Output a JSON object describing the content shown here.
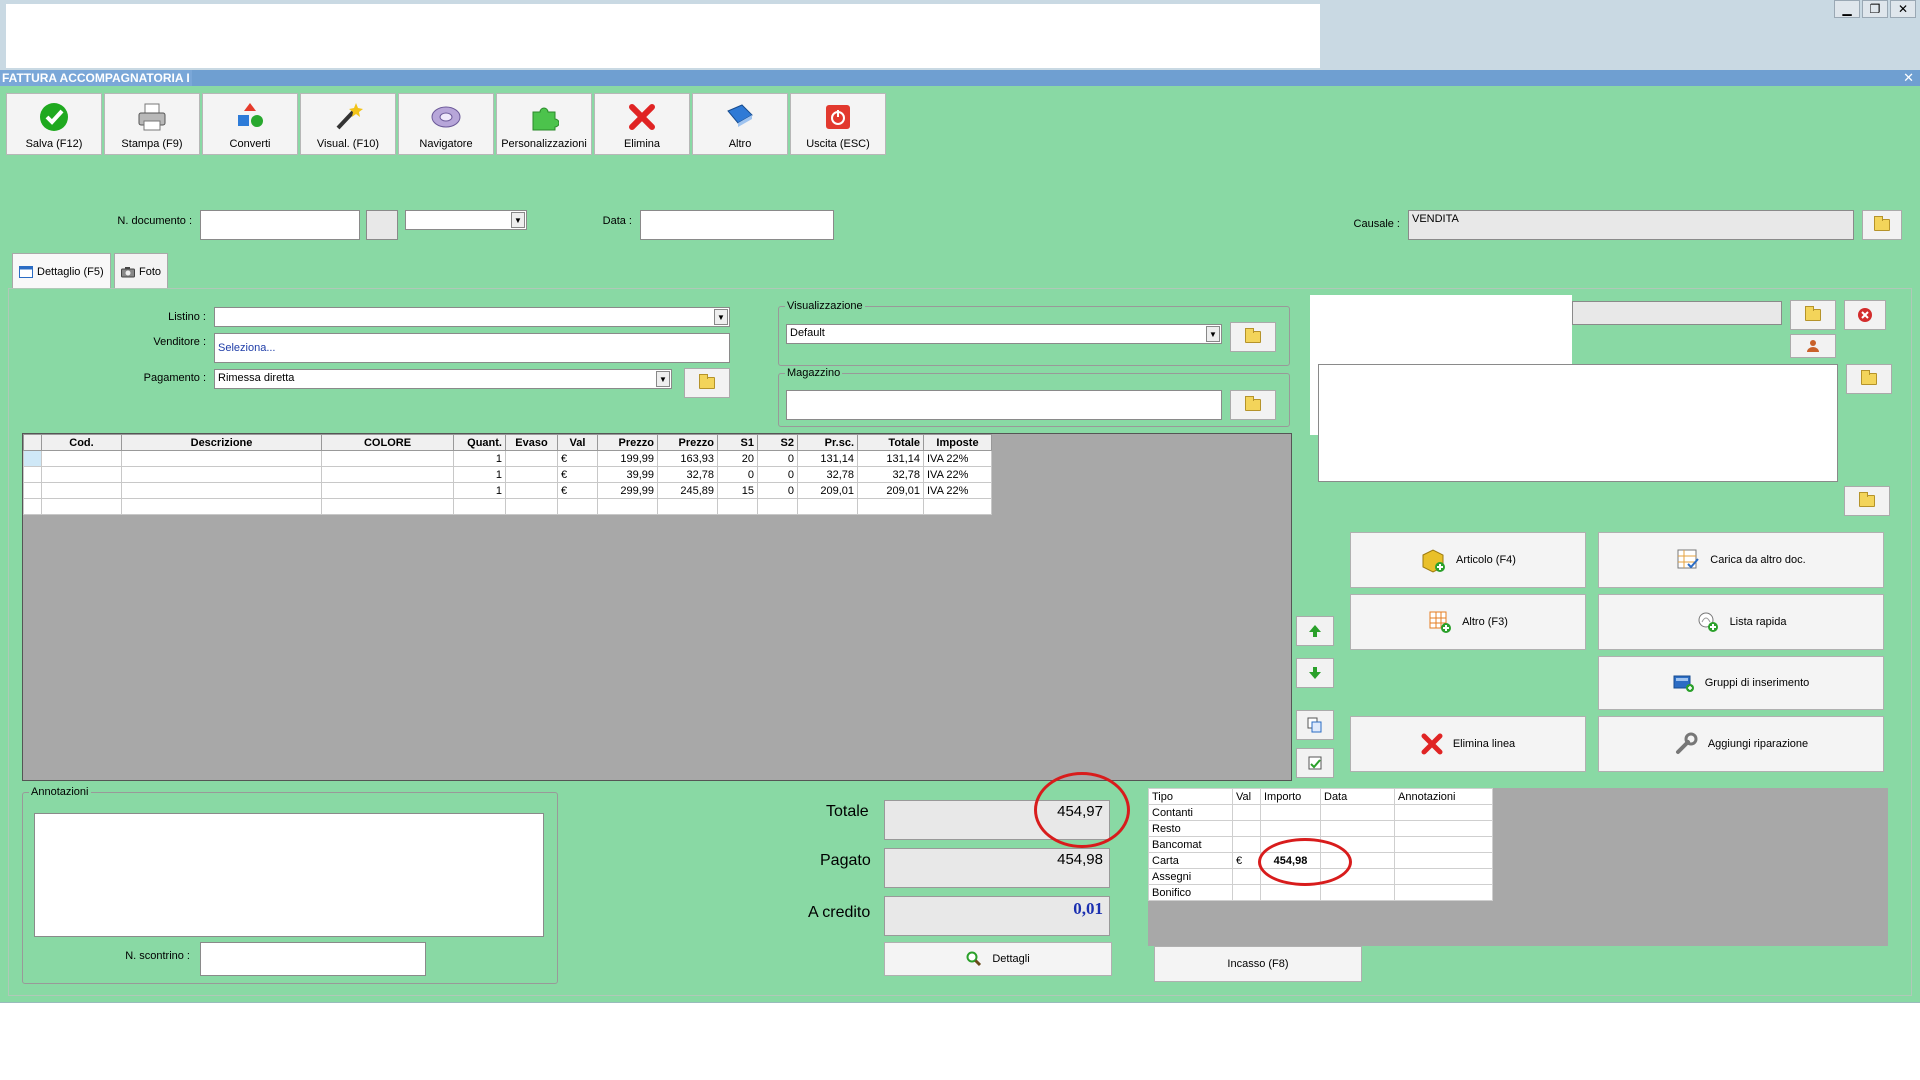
{
  "window": {
    "title": "FATTURA ACCOMPAGNATORIA I",
    "close_glyph": "✕",
    "controls": [
      "▁",
      "❐",
      "✕"
    ]
  },
  "toolbar": [
    {
      "name": "salva-button",
      "icon": "check-icon",
      "label": "Salva (F12)"
    },
    {
      "name": "stampa-button",
      "icon": "printer-icon",
      "label": "Stampa (F9)"
    },
    {
      "name": "converti-button",
      "icon": "convert-icon",
      "label": "Converti"
    },
    {
      "name": "visual-button",
      "icon": "magic-wand-icon",
      "label": "Visual. (F10)"
    },
    {
      "name": "navigatore-button",
      "icon": "disc-icon",
      "label": "Navigatore"
    },
    {
      "name": "personalizzazioni-button",
      "icon": "puzzle-icon",
      "label": "Personalizzazioni"
    },
    {
      "name": "elimina-button",
      "icon": "red-x-icon",
      "label": "Elimina"
    },
    {
      "name": "altro-button",
      "icon": "book-icon",
      "label": "Altro"
    },
    {
      "name": "uscita-button",
      "icon": "power-icon",
      "label": "Uscita (ESC)"
    }
  ],
  "header": {
    "n_documento_label": "N. documento :",
    "n_documento_value": "",
    "data_label": "Data :",
    "data_value": "",
    "causale_label": "Causale :",
    "causale_value": "VENDITA"
  },
  "tabs": [
    {
      "label": "Dettaglio (F5)",
      "icon": "window-icon"
    },
    {
      "label": "Foto",
      "icon": "camera-icon"
    }
  ],
  "form": {
    "listino_label": "Listino :",
    "listino_value": "",
    "venditore_label": "Venditore :",
    "venditore_value": "Seleziona...",
    "pagamento_label": "Pagamento :",
    "pagamento_value": "Rimessa diretta",
    "visualizzazione_legend": "Visualizzazione",
    "visualizzazione_value": "Default",
    "magazzino_legend": "Magazzino",
    "magazzino_value": ""
  },
  "grid": {
    "columns": [
      "Cod.",
      "Descrizione",
      "COLORE",
      "Quant.",
      "Evaso",
      "Val",
      "Prezzo",
      "Prezzo",
      "S1",
      "S2",
      "Pr.sc.",
      "Totale",
      "Imposte"
    ],
    "rows": [
      [
        "",
        "",
        "",
        "1",
        "",
        "€",
        "199,99",
        "163,93",
        "20",
        "0",
        "131,14",
        "131,14",
        "IVA 22%"
      ],
      [
        "",
        "",
        "",
        "1",
        "",
        "€",
        "39,99",
        "32,78",
        "0",
        "0",
        "32,78",
        "32,78",
        "IVA 22%"
      ],
      [
        "",
        "",
        "",
        "1",
        "",
        "€",
        "299,99",
        "245,89",
        "15",
        "0",
        "209,01",
        "209,01",
        "IVA 22%"
      ],
      [
        "",
        "",
        "",
        "",
        "",
        "",
        "",
        "",
        "",
        "",
        "",
        "",
        ""
      ]
    ]
  },
  "actions": {
    "articolo": "Articolo (F4)",
    "carica": "Carica da altro doc.",
    "altro": "Altro (F3)",
    "lista_rapida": "Lista rapida",
    "gruppi": "Gruppi di inserimento",
    "elimina_linea": "Elimina linea",
    "aggiungi_riparazione": "Aggiungi riparazione"
  },
  "annotazioni": {
    "legend": "Annotazioni",
    "value": "",
    "scontrino_label": "N. scontrino :",
    "scontrino_value": ""
  },
  "totals": {
    "totale_label": "Totale",
    "totale_value": "454,97",
    "pagato_label": "Pagato",
    "pagato_value": "454,98",
    "credito_label": "A credito",
    "credito_value": "0,01",
    "dettagli_label": "Dettagli"
  },
  "payments": {
    "columns": [
      "Tipo",
      "Val",
      "Importo",
      "Data",
      "Annotazioni"
    ],
    "rows": [
      [
        "Contanti",
        "",
        "",
        "",
        ""
      ],
      [
        "Resto",
        "",
        "",
        "",
        ""
      ],
      [
        "Bancomat",
        "",
        "",
        "",
        ""
      ],
      [
        "Carta",
        "€",
        "454,98",
        "",
        ""
      ],
      [
        "Assegni",
        "",
        "",
        "",
        ""
      ],
      [
        "Bonifico",
        "",
        "",
        "",
        ""
      ]
    ],
    "incasso_label": "Incasso (F8)"
  },
  "colors": {
    "background": "#89d9a4",
    "title_bar": "#6f9fd1",
    "highlight_ellipse": "#d81c1c",
    "credit_value": "#1a2fb0"
  }
}
